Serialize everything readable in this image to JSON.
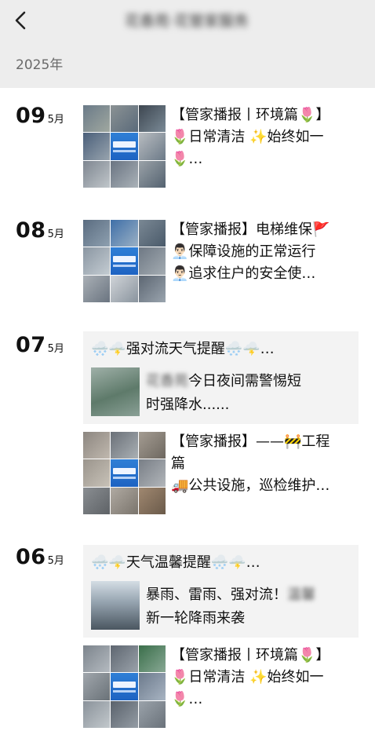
{
  "header": {
    "back_label": "‹",
    "title": "花香苑·花管家服务"
  },
  "year_label": "2025年",
  "colors": {
    "header_bg": "#ededed",
    "card_bg": "#f3f3f3",
    "accent_blue": "#1e63c2"
  },
  "entries": [
    {
      "day": "09",
      "month": "5月",
      "post": {
        "line1": "【管家播报丨环境篇🌷】",
        "line2": "🌷日常清洁 ✨始终如一",
        "line3": "🌷…"
      }
    },
    {
      "day": "08",
      "month": "5月",
      "post": {
        "line1": "【管家播报】电梯维保🚩",
        "line2": "👨🏻‍💼保障设施的正常运行",
        "line3": "👨🏻‍💼追求住户的安全使…"
      }
    },
    {
      "day": "07",
      "month": "5月",
      "card": {
        "title": "🌨️🌩️强对流天气提醒🌨️🌩️…",
        "text_prefix": "花香苑",
        "text1": "今日夜间需警惕短",
        "text2": "时强降水......"
      },
      "post": {
        "line1": "【管家播报】——🚧工程",
        "line2": "篇",
        "line3": "🚚公共设施，巡检维护…"
      }
    },
    {
      "day": "06",
      "month": "5月",
      "card": {
        "title": "🌨️🌩️天气温馨提醒🌨️🌩️…",
        "text1": "暴雨、雷雨、强对流！",
        "text1_blur": "温馨",
        "text2": "新一轮降雨来袭"
      },
      "post": {
        "line1": "【管家播报丨环境篇🌷】",
        "line2": "🌷日常清洁 ✨始终如一",
        "line3": "🌷…"
      }
    }
  ]
}
